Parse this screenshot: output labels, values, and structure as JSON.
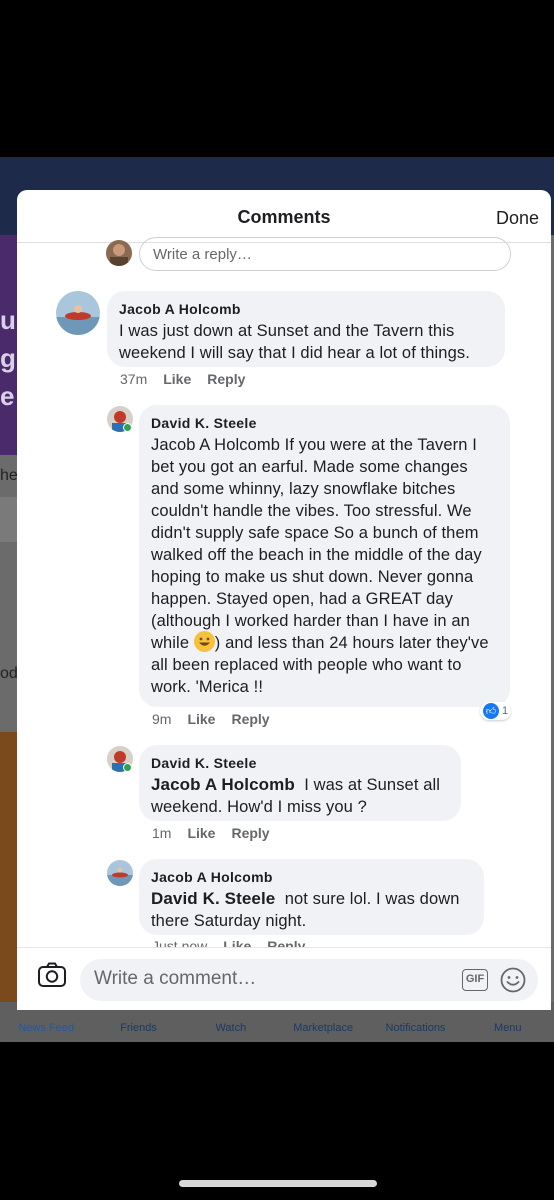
{
  "background": {
    "tabs": [
      "News Feed",
      "Friends",
      "Watch",
      "Marketplace",
      "Notifications",
      "Menu"
    ],
    "edge_letters": [
      "u",
      "g",
      "e"
    ],
    "edge_texts": [
      "he",
      "oda"
    ]
  },
  "modal": {
    "title": "Comments",
    "done_label": "Done",
    "reply_placeholder": "Write a reply…"
  },
  "comments": [
    {
      "author": "Jacob A Holcomb",
      "text": "I was just down at Sunset and the Tavern this weekend I will say that I did hear a lot of things.",
      "time": "37m",
      "like": "Like",
      "reply": "Reply"
    },
    {
      "author": "David K. Steele",
      "text_before_emoji": "Jacob A Holcomb If you were at the Tavern I bet you got an earful. Made some changes and some whinny, lazy snowflake bitches couldn't handle the vibes. Too stressful. We didn't supply safe space So a bunch of them walked off the beach in the middle of the day hoping to make us shut down. Never gonna happen. Stayed open, had a GREAT day (although I worked harder than I have in an while",
      "text_after_emoji": ") and less than 24 hours later they've all been replaced with people who want to work. 'Merica !!",
      "time": "9m",
      "like": "Like",
      "reply": "Reply",
      "reaction_count": "1"
    },
    {
      "author": "David K. Steele",
      "mention": "Jacob A Holcomb",
      "text": "I was at Sunset all weekend. How'd I miss you ?",
      "time": "1m",
      "like": "Like",
      "reply": "Reply"
    },
    {
      "author": "Jacob A Holcomb",
      "mention": "David K. Steele",
      "text": "not sure lol. I was down there Saturday night.",
      "time": "Just now",
      "like": "Like",
      "reply": "Reply"
    }
  ],
  "composer": {
    "placeholder": "Write a comment…",
    "gif_label": "GIF"
  },
  "colors": {
    "link_blue": "#1877f2",
    "bubble_gray": "#f0f2f5",
    "online_green": "#31a24c"
  },
  "icons": [
    "camera-icon",
    "gif-icon",
    "smile-icon",
    "like-reaction-icon",
    "grinning-emoji"
  ]
}
